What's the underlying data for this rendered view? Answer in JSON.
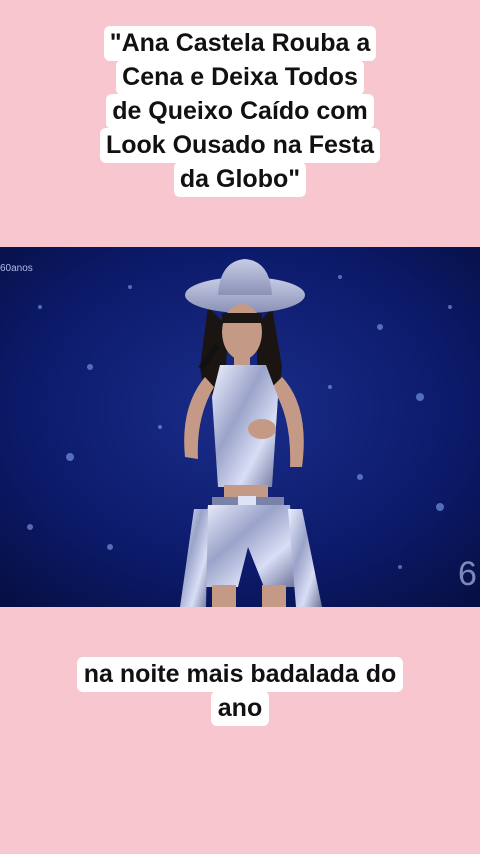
{
  "title_caption": {
    "lines": [
      "\"Ana Castela Rouba a",
      "Cena e Deixa Todos",
      "de Queixo Caído com",
      "Look Ousado na Festa",
      "da Globo\""
    ]
  },
  "video": {
    "watermark": "60anos",
    "corner_mark": "6"
  },
  "bottom_caption": {
    "lines": [
      "na noite mais badalada do",
      "ano"
    ]
  },
  "colors": {
    "background": "#f8c6cf",
    "caption_bg": "#ffffff",
    "stage_blue": "#0a1660"
  }
}
